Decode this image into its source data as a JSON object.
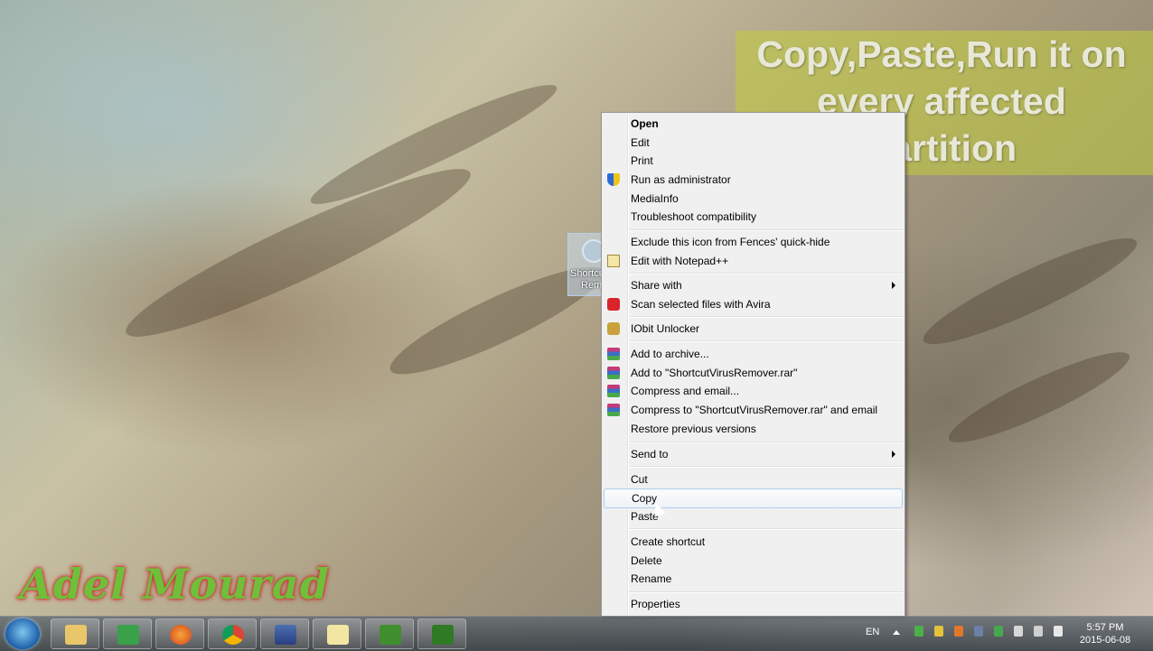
{
  "desktop": {
    "icon_label_line1": "Shortcu",
    "icon_label_line2": "Rem"
  },
  "caption": {
    "line1": "Copy,Paste,Run it on",
    "line2": "every affected",
    "line3": "Partition"
  },
  "watermark": "Adel Mourad",
  "context_menu": {
    "items": [
      {
        "label": "Open"
      },
      {
        "label": "Edit"
      },
      {
        "label": "Print"
      },
      {
        "label": "Run as administrator",
        "icon": "shield-icon"
      },
      {
        "label": "MediaInfo"
      },
      {
        "label": "Troubleshoot compatibility"
      },
      {
        "label": "Exclude this icon from Fences' quick-hide"
      },
      {
        "label": "Edit with Notepad++",
        "icon": "notepad-icon"
      },
      {
        "label": "Share with"
      },
      {
        "label": "Scan selected files with Avira",
        "icon": "avira-icon"
      },
      {
        "label": "IObit Unlocker",
        "icon": "unlock-icon"
      },
      {
        "label": "Add to archive...",
        "icon": "winrar-icon"
      },
      {
        "label": "Add to \"ShortcutVirusRemover.rar\"",
        "icon": "winrar-icon"
      },
      {
        "label": "Compress and email...",
        "icon": "winrar-icon"
      },
      {
        "label": "Compress to \"ShortcutVirusRemover.rar\" and email",
        "icon": "winrar-icon"
      },
      {
        "label": "Restore previous versions"
      },
      {
        "label": "Send to"
      },
      {
        "label": "Cut"
      },
      {
        "label": "Copy"
      },
      {
        "label": "Paste"
      },
      {
        "label": "Create shortcut"
      },
      {
        "label": "Delete"
      },
      {
        "label": "Rename"
      },
      {
        "label": "Properties"
      }
    ]
  },
  "taskbar": {
    "apps": [
      "explorer-icon",
      "task-manager-icon",
      "firefox-icon",
      "chrome-icon",
      "control-panel-icon",
      "folder-icon",
      "camtasia-icon",
      "camtasia-recorder-icon"
    ],
    "language": "EN",
    "time": "5:57 PM",
    "date": "2015-06-08"
  }
}
